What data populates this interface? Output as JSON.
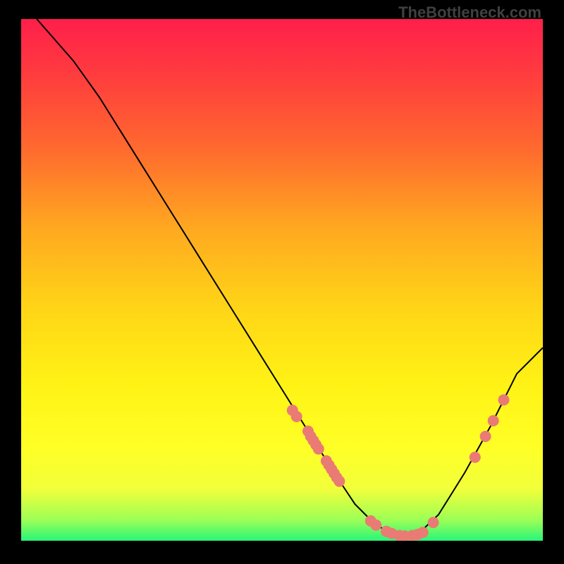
{
  "watermark": "TheBottleneck.com",
  "chart_data": {
    "type": "line",
    "title": "",
    "xlabel": "",
    "ylabel": "",
    "xlim": [
      0,
      100
    ],
    "ylim": [
      0,
      100
    ],
    "curve": {
      "x": [
        3,
        10,
        15,
        20,
        25,
        30,
        35,
        40,
        45,
        50,
        55,
        60,
        62,
        64,
        66,
        68,
        70,
        72,
        74,
        76,
        80,
        85,
        90,
        95,
        100
      ],
      "y": [
        100,
        92,
        85,
        77,
        69,
        61,
        53,
        45,
        37,
        29,
        21,
        13,
        10,
        7,
        5,
        3,
        2,
        1.2,
        0.8,
        1.2,
        5,
        13,
        22,
        32,
        37
      ]
    },
    "clusters": [
      {
        "x": 52,
        "y": 25
      },
      {
        "x": 52.8,
        "y": 23.8
      },
      {
        "x": 55,
        "y": 21
      },
      {
        "x": 55.5,
        "y": 20
      },
      {
        "x": 56,
        "y": 19.2
      },
      {
        "x": 56.5,
        "y": 18.4
      },
      {
        "x": 57,
        "y": 17.6
      },
      {
        "x": 58.5,
        "y": 15.3
      },
      {
        "x": 59,
        "y": 14.5
      },
      {
        "x": 59.5,
        "y": 13.7
      },
      {
        "x": 60,
        "y": 12.9
      },
      {
        "x": 60.5,
        "y": 12.1
      },
      {
        "x": 61,
        "y": 11.4
      },
      {
        "x": 67,
        "y": 3.8
      },
      {
        "x": 68,
        "y": 3
      },
      {
        "x": 70,
        "y": 1.8
      },
      {
        "x": 71,
        "y": 1.4
      },
      {
        "x": 72.5,
        "y": 1.0
      },
      {
        "x": 73.5,
        "y": 0.9
      },
      {
        "x": 75,
        "y": 1.0
      },
      {
        "x": 76,
        "y": 1.2
      },
      {
        "x": 77,
        "y": 1.6
      },
      {
        "x": 79,
        "y": 3.5
      },
      {
        "x": 87,
        "y": 16
      },
      {
        "x": 89,
        "y": 20
      },
      {
        "x": 90.5,
        "y": 23
      },
      {
        "x": 92.5,
        "y": 27
      }
    ]
  }
}
